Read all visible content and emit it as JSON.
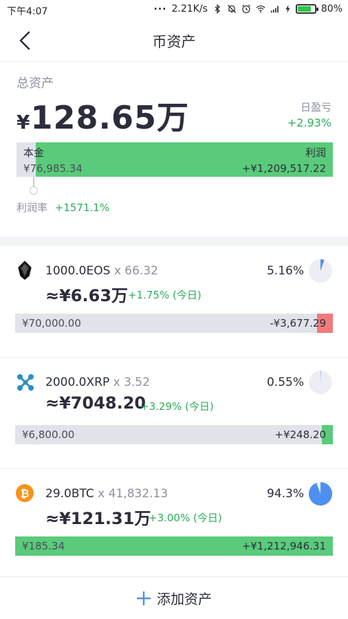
{
  "status_bar": {
    "time": "下午4:07",
    "dots": "...",
    "speed": "2.21K/s",
    "battery": "80%",
    "battery_level": 0.8
  },
  "nav": {
    "title": "币资产"
  },
  "summary": {
    "total_label": "总资产",
    "currency_symbol": "¥",
    "total_amount": "128.65万",
    "day_label": "日盈亏",
    "day_value": "+2.93%",
    "principal_label": "本金",
    "profit_label": "利润",
    "principal_value": "¥76,985.34",
    "profit_value": "+¥1,209,517.22",
    "principal_share": 0.06,
    "rate_label": "利润率",
    "rate_value": "+1571.1%"
  },
  "assets": [
    {
      "coin": "EOS",
      "icon": "eos-icon",
      "holding": "1000.0EOS",
      "multiplier": "x 66.32",
      "value": "≈¥6.63万",
      "change": "+1.75% (今日)",
      "portfolio_pct": "5.16%",
      "portfolio_fraction": 0.0516,
      "cost": "¥70,000.00",
      "pnl": "-¥3,677.29",
      "pnl_fraction": 0.05,
      "pnl_color": "#f07a7a"
    },
    {
      "coin": "XRP",
      "icon": "xrp-icon",
      "holding": "2000.0XRP",
      "multiplier": "x 3.52",
      "value": "≈¥7048.20",
      "change": "+3.29% (今日)",
      "portfolio_pct": "0.55%",
      "portfolio_fraction": 0.0055,
      "cost": "¥6,800.00",
      "pnl": "+¥248.20",
      "pnl_fraction": 0.035,
      "pnl_color": "#5acb7a"
    },
    {
      "coin": "BTC",
      "icon": "btc-icon",
      "holding": "29.0BTC",
      "multiplier": "x 41,832.13",
      "value": "≈¥121.31万",
      "change": "+3.00% (今日)",
      "portfolio_pct": "94.3%",
      "portfolio_fraction": 0.943,
      "cost": "¥185.34",
      "pnl": "+¥1,212,946.31",
      "pnl_fraction": 1.0,
      "pnl_color": "#5acb7a"
    }
  ],
  "footer": {
    "add_label": "添加资产"
  },
  "colors": {
    "accent_blue": "#4f8ff0",
    "profit_green": "#5acb7a",
    "text_green": "#2cae5a",
    "loss_red": "#f07a7a"
  }
}
